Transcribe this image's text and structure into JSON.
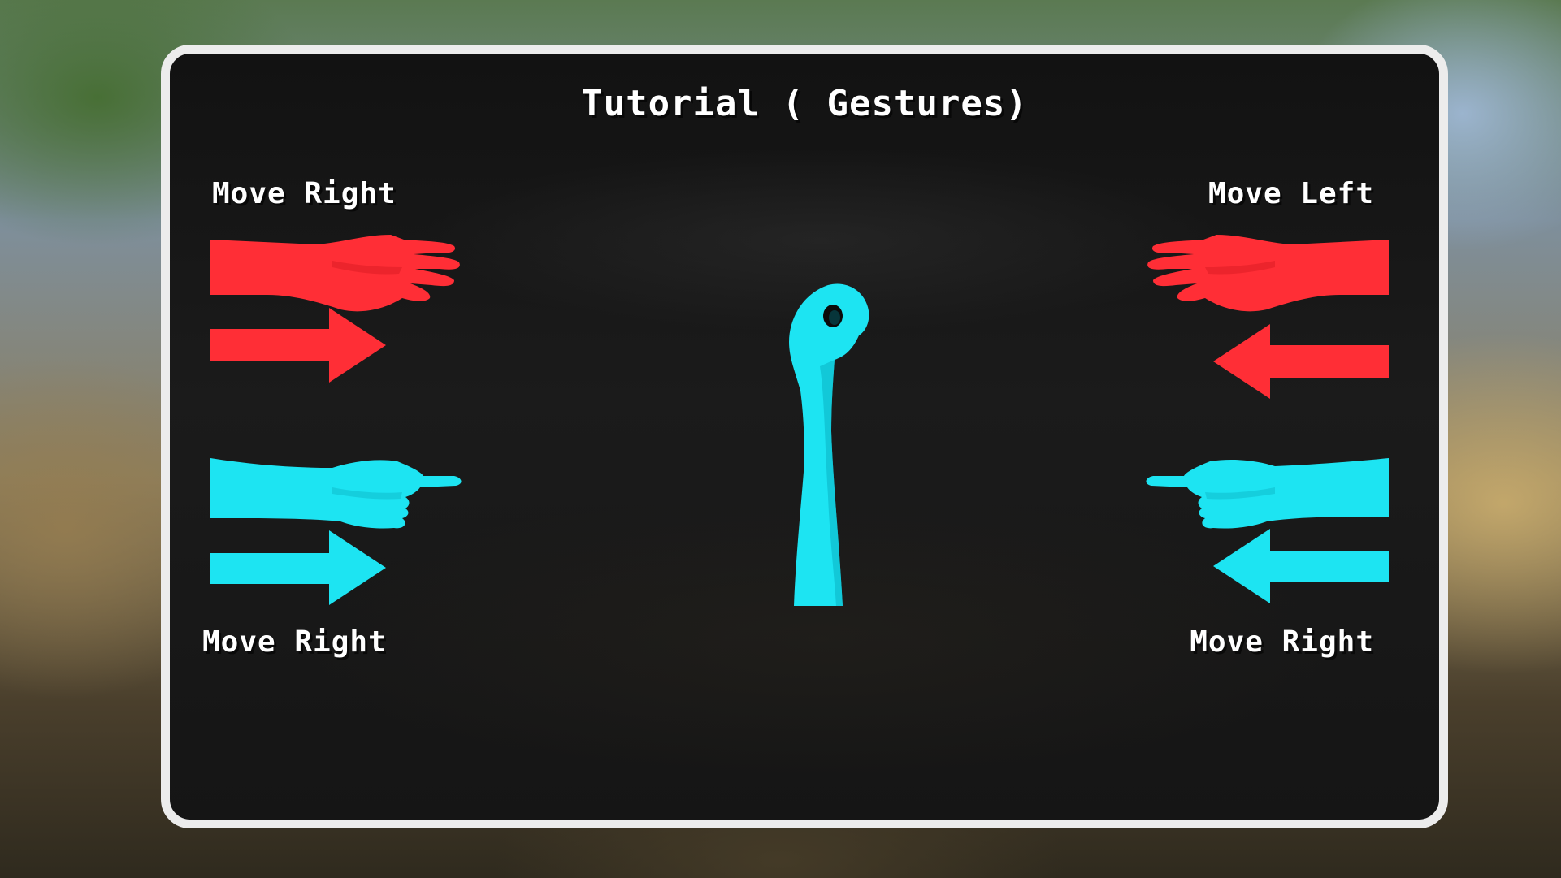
{
  "title": "Tutorial ( Gestures)",
  "gestures": {
    "top_left": {
      "label": "Move Right",
      "icon": "open-hand-right-icon",
      "arrow": "arrow-right-icon",
      "color": "#ff2e36"
    },
    "top_right": {
      "label": "Move Left",
      "icon": "open-hand-left-icon",
      "arrow": "arrow-left-icon",
      "color": "#ff2e36"
    },
    "bottom_left": {
      "label": "Move Right",
      "icon": "pointing-hand-right-icon",
      "arrow": "arrow-right-icon",
      "color": "#1de4f2"
    },
    "bottom_right": {
      "label": "Move Right",
      "icon": "pointing-hand-left-icon",
      "arrow": "arrow-left-icon",
      "color": "#1de4f2"
    },
    "center": {
      "icon": "raised-fist-okay-hand-icon",
      "color": "#1de4f2"
    }
  },
  "colors": {
    "panel_border": "#ececec",
    "panel_background": "#161616",
    "text": "#ffffff"
  }
}
